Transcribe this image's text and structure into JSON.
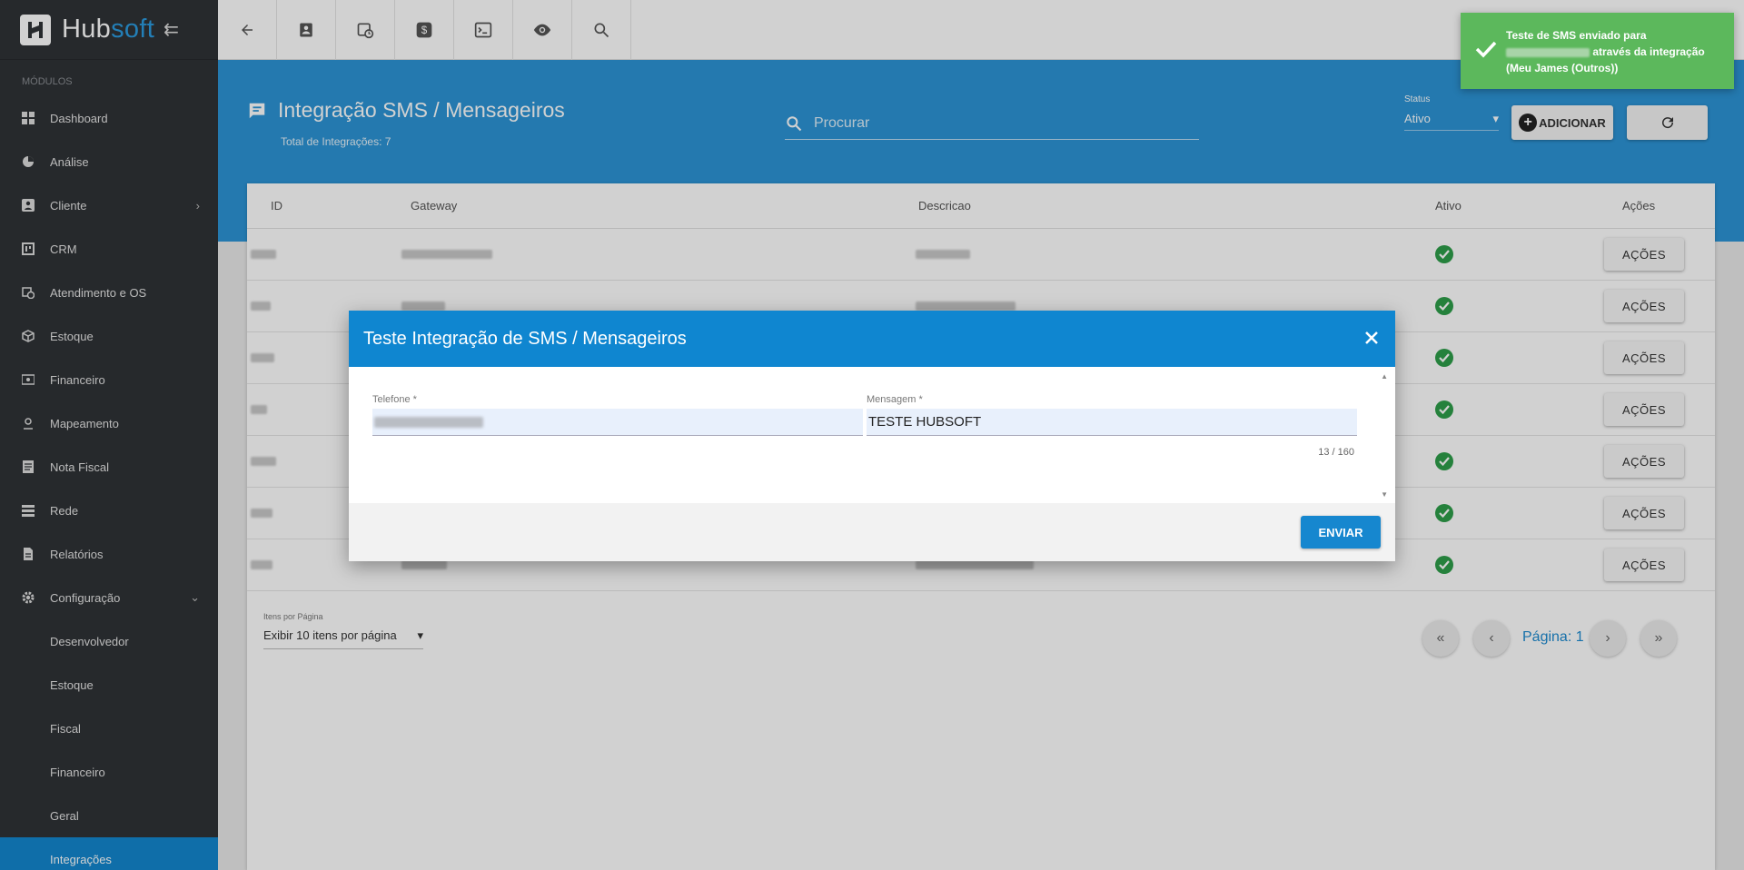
{
  "app": {
    "logo_main": "Hub",
    "logo_accent": "soft"
  },
  "sidebar": {
    "modules_label": "MÓDULOS",
    "items": [
      {
        "label": "Dashboard",
        "icon": "dashboard-icon"
      },
      {
        "label": "Análise",
        "icon": "pie-chart-icon"
      },
      {
        "label": "Cliente",
        "icon": "person-badge-icon",
        "chevron": "›"
      },
      {
        "label": "CRM",
        "icon": "board-icon"
      },
      {
        "label": "Atendimento e OS",
        "icon": "calendar-clock-icon"
      },
      {
        "label": "Estoque",
        "icon": "box-icon"
      },
      {
        "label": "Financeiro",
        "icon": "money-icon"
      },
      {
        "label": "Mapeamento",
        "icon": "map-person-icon"
      },
      {
        "label": "Nota Fiscal",
        "icon": "document-icon"
      },
      {
        "label": "Rede",
        "icon": "server-icon"
      },
      {
        "label": "Relatórios",
        "icon": "report-icon"
      },
      {
        "label": "Configuração",
        "icon": "gear-icon",
        "chevron": "⌄"
      }
    ],
    "subitems": [
      "Desenvolvedor",
      "Estoque",
      "Fiscal",
      "Financeiro",
      "Geral",
      "Integrações"
    ]
  },
  "header": {
    "title": "Integração SMS / Mensageiros",
    "subtitle": "Total de Integrações: 7",
    "search_placeholder": "Procurar",
    "status_label": "Status",
    "status_value": "Ativo",
    "add_label": "ADICIONAR"
  },
  "table": {
    "columns": {
      "id": "ID",
      "gateway": "Gateway",
      "descricao": "Descricao",
      "ativo": "Ativo",
      "acoes": "Ações"
    },
    "action_label": "AÇÕES",
    "row_count": 7
  },
  "pagination": {
    "items_per_page_label": "Itens por Página",
    "items_per_page_value": "Exibir 10 itens por página",
    "page_label": "Página: 1"
  },
  "modal": {
    "title": "Teste Integração de SMS / Mensageiros",
    "phone_label": "Telefone *",
    "message_label": "Mensagem *",
    "message_value": "TESTE HUBSOFT",
    "counter": "13 / 160",
    "send_label": "ENVIAR"
  },
  "toast": {
    "line1": "Teste de SMS enviado para",
    "line2": "através da integração",
    "line3": "(Meu James (Outros))",
    "color": "#5cb85c"
  },
  "colors": {
    "primary": "#2c94d6",
    "sidebar": "#2f3236",
    "success": "#2e9e4a"
  }
}
